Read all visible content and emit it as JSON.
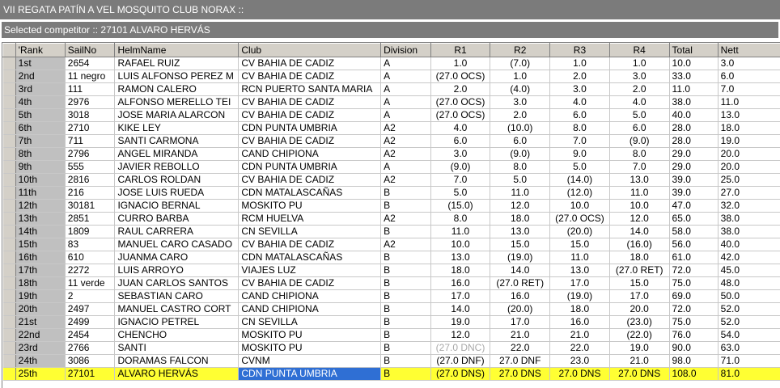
{
  "window": {
    "title": "VII REGATA PATÍN A VEL MOSQUITO CLUB NORAX ::",
    "selected_label": "Selected competitor :: 27101 ALVARO HERVÁS"
  },
  "table": {
    "columns": [
      "'Rank",
      "SailNo",
      "HelmName",
      "Club",
      "Division",
      "R1",
      "R2",
      "R3",
      "R4",
      "Total",
      "Nett"
    ],
    "rows": [
      {
        "rank": "1st",
        "sail": "2654",
        "helm": "RAFAEL RUIZ",
        "club": "CV BAHIA DE CADIZ",
        "div": "A",
        "r1": "1.0",
        "r2": "(7.0)",
        "r3": "1.0",
        "r4": "1.0",
        "total": "10.0",
        "nett": "3.0"
      },
      {
        "rank": "2nd",
        "sail": "11 negro",
        "helm": "LUIS ALFONSO PEREZ M",
        "club": "CV BAHIA DE CADIZ",
        "div": "A",
        "r1": "(27.0 OCS)",
        "r2": "1.0",
        "r3": "2.0",
        "r4": "3.0",
        "total": "33.0",
        "nett": "6.0"
      },
      {
        "rank": "3rd",
        "sail": "111",
        "helm": "RAMON CALERO",
        "club": "RCN PUERTO SANTA MARIA",
        "div": "A",
        "r1": "2.0",
        "r2": "(4.0)",
        "r3": "3.0",
        "r4": "2.0",
        "total": "11.0",
        "nett": "7.0"
      },
      {
        "rank": "4th",
        "sail": "2976",
        "helm": "ALFONSO MERELLO TEI",
        "club": "CV BAHIA DE CADIZ",
        "div": "A",
        "r1": "(27.0 OCS)",
        "r2": "3.0",
        "r3": "4.0",
        "r4": "4.0",
        "total": "38.0",
        "nett": "11.0"
      },
      {
        "rank": "5th",
        "sail": "3018",
        "helm": "JOSE MARIA ALARCON",
        "club": "CV BAHIA DE CADIZ",
        "div": "A",
        "r1": "(27.0 OCS)",
        "r2": "2.0",
        "r3": "6.0",
        "r4": "5.0",
        "total": "40.0",
        "nett": "13.0"
      },
      {
        "rank": "6th",
        "sail": "2710",
        "helm": "KIKE LEY",
        "club": "CDN PUNTA UMBRIA",
        "div": "A2",
        "r1": "4.0",
        "r2": "(10.0)",
        "r3": "8.0",
        "r4": "6.0",
        "total": "28.0",
        "nett": "18.0"
      },
      {
        "rank": "7th",
        "sail": "711",
        "helm": "SANTI CARMONA",
        "club": "CV BAHIA DE CADIZ",
        "div": "A2",
        "r1": "6.0",
        "r2": "6.0",
        "r3": "7.0",
        "r4": "(9.0)",
        "total": "28.0",
        "nett": "19.0"
      },
      {
        "rank": "8th",
        "sail": "2796",
        "helm": "ANGEL MIRANDA",
        "club": "CAND CHIPIONA",
        "div": "A2",
        "r1": "3.0",
        "r2": "(9.0)",
        "r3": "9.0",
        "r4": "8.0",
        "total": "29.0",
        "nett": "20.0"
      },
      {
        "rank": "9th",
        "sail": "555",
        "helm": "JAVIER REBOLLO",
        "club": "CDN PUNTA UMBRIA",
        "div": "A",
        "r1": "(9.0)",
        "r2": "8.0",
        "r3": "5.0",
        "r4": "7.0",
        "total": "29.0",
        "nett": "20.0"
      },
      {
        "rank": "10th",
        "sail": "2816",
        "helm": "CARLOS ROLDAN",
        "club": "CV BAHIA DE CADIZ",
        "div": "A2",
        "r1": "7.0",
        "r2": "5.0",
        "r3": "(14.0)",
        "r4": "13.0",
        "total": "39.0",
        "nett": "25.0"
      },
      {
        "rank": "11th",
        "sail": "216",
        "helm": "JOSE LUIS RUEDA",
        "club": "CDN MATALASCAÑAS",
        "div": "B",
        "r1": "5.0",
        "r2": "11.0",
        "r3": "(12.0)",
        "r4": "11.0",
        "total": "39.0",
        "nett": "27.0"
      },
      {
        "rank": "12th",
        "sail": "30181",
        "helm": "IGNACIO BERNAL",
        "club": "MOSKITO PU",
        "div": "B",
        "r1": "(15.0)",
        "r2": "12.0",
        "r3": "10.0",
        "r4": "10.0",
        "total": "47.0",
        "nett": "32.0"
      },
      {
        "rank": "13th",
        "sail": "2851",
        "helm": "CURRO BARBA",
        "club": "RCM HUELVA",
        "div": "A2",
        "r1": "8.0",
        "r2": "18.0",
        "r3": "(27.0 OCS)",
        "r4": "12.0",
        "total": "65.0",
        "nett": "38.0"
      },
      {
        "rank": "14th",
        "sail": "1809",
        "helm": "RAUL CARRERA",
        "club": "CN SEVILLA",
        "div": "B",
        "r1": "11.0",
        "r2": "13.0",
        "r3": "(20.0)",
        "r4": "14.0",
        "total": "58.0",
        "nett": "38.0"
      },
      {
        "rank": "15th",
        "sail": "83",
        "helm": "MANUEL CARO CASADO",
        "club": "CV BAHIA DE CADIZ",
        "div": "A2",
        "r1": "10.0",
        "r2": "15.0",
        "r3": "15.0",
        "r4": "(16.0)",
        "total": "56.0",
        "nett": "40.0"
      },
      {
        "rank": "16th",
        "sail": "610",
        "helm": "JUANMA CARO",
        "club": "CDN MATALASCAÑAS",
        "div": "B",
        "r1": "13.0",
        "r2": "(19.0)",
        "r3": "11.0",
        "r4": "18.0",
        "total": "61.0",
        "nett": "42.0"
      },
      {
        "rank": "17th",
        "sail": "2272",
        "helm": "LUIS ARROYO",
        "club": "VIAJES LUZ",
        "div": "B",
        "r1": "18.0",
        "r2": "14.0",
        "r3": "13.0",
        "r4": "(27.0 RET)",
        "total": "72.0",
        "nett": "45.0"
      },
      {
        "rank": "18th",
        "sail": "11 verde",
        "helm": "JUAN CARLOS SANTOS",
        "club": "CV BAHIA DE CADIZ",
        "div": "B",
        "r1": "16.0",
        "r2": "(27.0 RET)",
        "r3": "17.0",
        "r4": "15.0",
        "total": "75.0",
        "nett": "48.0"
      },
      {
        "rank": "19th",
        "sail": "2",
        "helm": "SEBASTIAN CARO",
        "club": "CAND CHIPIONA",
        "div": "B",
        "r1": "17.0",
        "r2": "16.0",
        "r3": "(19.0)",
        "r4": "17.0",
        "total": "69.0",
        "nett": "50.0"
      },
      {
        "rank": "20th",
        "sail": "2497",
        "helm": "MANUEL CASTRO CORT",
        "club": "CAND CHIPIONA",
        "div": "B",
        "r1": "14.0",
        "r2": "(20.0)",
        "r3": "18.0",
        "r4": "20.0",
        "total": "72.0",
        "nett": "52.0"
      },
      {
        "rank": "21st",
        "sail": "2499",
        "helm": "IGNACIO PETREL",
        "club": "CN SEVILLA",
        "div": "B",
        "r1": "19.0",
        "r2": "17.0",
        "r3": "16.0",
        "r4": "(23.0)",
        "total": "75.0",
        "nett": "52.0"
      },
      {
        "rank": "22nd",
        "sail": "2454",
        "helm": "CHENCHO",
        "club": "MOSKITO PU",
        "div": "B",
        "r1": "12.0",
        "r2": "21.0",
        "r3": "21.0",
        "r4": "(22.0)",
        "total": "76.0",
        "nett": "54.0"
      },
      {
        "rank": "23rd",
        "sail": "2766",
        "helm": "SANTI",
        "club": "MOSKITO PU",
        "div": "B",
        "r1": "(27.0 DNC)",
        "r2": "22.0",
        "r3": "22.0",
        "r4": "19.0",
        "total": "90.0",
        "nett": "63.0",
        "r1_dim": true
      },
      {
        "rank": "24th",
        "sail": "3086",
        "helm": "DORAMAS FALCON",
        "club": "CVNM",
        "div": "B",
        "r1": "(27.0 DNF)",
        "r2": "27.0 DNF",
        "r3": "23.0",
        "r4": "21.0",
        "total": "98.0",
        "nett": "71.0"
      },
      {
        "rank": "25th",
        "sail": "27101",
        "helm": "ALVARO HERVÁS",
        "club": "CDN PUNTA UMBRIA",
        "div": "B",
        "r1": "(27.0 DNS)",
        "r2": "27.0 DNS",
        "r3": "27.0 DNS",
        "r4": "27.0 DNS",
        "total": "108.0",
        "nett": "81.0",
        "selected": true
      }
    ]
  },
  "colors": {
    "title_bar": "#7b7b7b",
    "selected_row": "#ffff33",
    "selected_cell": "#2f6fd4",
    "header_bg": "#d4d0c8"
  }
}
